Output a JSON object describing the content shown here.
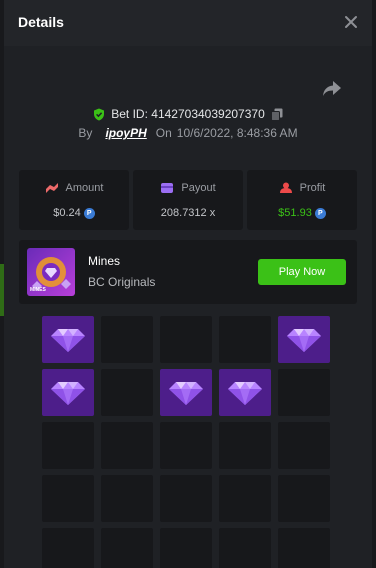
{
  "modal": {
    "title": "Details"
  },
  "bet": {
    "id_label": "Bet ID:",
    "id": "41427034039207370",
    "by_label": "By",
    "user": "ipoyPH",
    "on_label": "On",
    "date": "10/6/2022, 8:48:36 AM"
  },
  "stats": [
    {
      "label": "Amount",
      "value": "$0.24",
      "coin": true,
      "icon": "amount-icon",
      "color": "#ed6a6a"
    },
    {
      "label": "Payout",
      "value": "208.7312 x",
      "coin": false,
      "icon": "payout-icon",
      "color": "#9b6ef3"
    },
    {
      "label": "Profit",
      "value": "$51.93",
      "coin": true,
      "icon": "profit-icon",
      "color": "#ed4a4a",
      "value_color": "#3bc117"
    }
  ],
  "game": {
    "name": "Mines",
    "provider": "BC Originals",
    "play_label": "Play Now",
    "thumb_label": "MINES"
  },
  "coin_symbol": "P",
  "grid": {
    "rows": [
      [
        "gem",
        "empty",
        "empty",
        "empty",
        "gem"
      ],
      [
        "gem",
        "empty",
        "gem",
        "gem",
        "empty"
      ],
      [
        "empty",
        "empty",
        "empty",
        "empty",
        "empty"
      ],
      [
        "empty",
        "empty",
        "empty",
        "empty",
        "empty"
      ],
      [
        "empty",
        "empty",
        "empty",
        "empty",
        "empty"
      ]
    ]
  },
  "colors": {
    "accent_green": "#3bc117",
    "gem_tile": "#4d1e8a",
    "empty_tile": "#17181b",
    "panel_bg": "#1f2125"
  }
}
